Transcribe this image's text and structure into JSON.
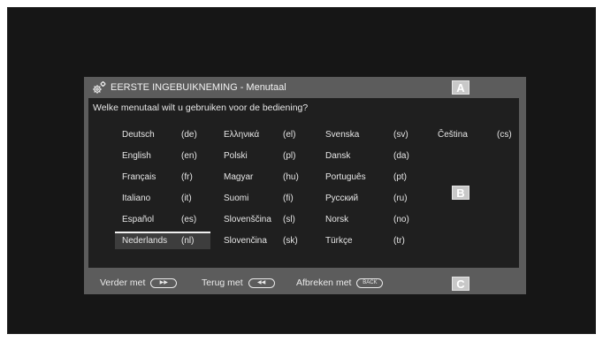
{
  "header": {
    "title": "EERSTE INGEBUIKNEMING - Menutaal"
  },
  "question": "Welke menutaal wilt u gebruiken voor de bediening?",
  "languages": [
    {
      "name": "Deutsch",
      "code": "(de)"
    },
    {
      "name": "English",
      "code": "(en)"
    },
    {
      "name": "Français",
      "code": "(fr)"
    },
    {
      "name": "Italiano",
      "code": "(it)"
    },
    {
      "name": "Español",
      "code": "(es)"
    },
    {
      "name": "Nederlands",
      "code": "(nl)"
    },
    {
      "name": "Ελληνικά",
      "code": "(el)"
    },
    {
      "name": "Polski",
      "code": "(pl)"
    },
    {
      "name": "Magyar",
      "code": "(hu)"
    },
    {
      "name": "Suomi",
      "code": "(fi)"
    },
    {
      "name": "Slovenščina",
      "code": "(sl)"
    },
    {
      "name": "Slovenčina",
      "code": "(sk)"
    },
    {
      "name": "Svenska",
      "code": "(sv)"
    },
    {
      "name": "Dansk",
      "code": "(da)"
    },
    {
      "name": "Português",
      "code": "(pt)"
    },
    {
      "name": "Русский",
      "code": "(ru)"
    },
    {
      "name": "Norsk",
      "code": "(no)"
    },
    {
      "name": "Türkçe",
      "code": "(tr)"
    },
    {
      "name": "Čeština",
      "code": "(cs)"
    }
  ],
  "selected_language": "Nederlands",
  "badges": {
    "a": "A",
    "b": "B",
    "c": "C"
  },
  "footer": {
    "next_label": "Verder met",
    "next_key": "▶▶",
    "back_label": "Terug met",
    "back_key": "◀◀",
    "cancel_label": "Afbreken met",
    "cancel_key": "BACK"
  },
  "icons": {
    "header": "gear-icon"
  }
}
